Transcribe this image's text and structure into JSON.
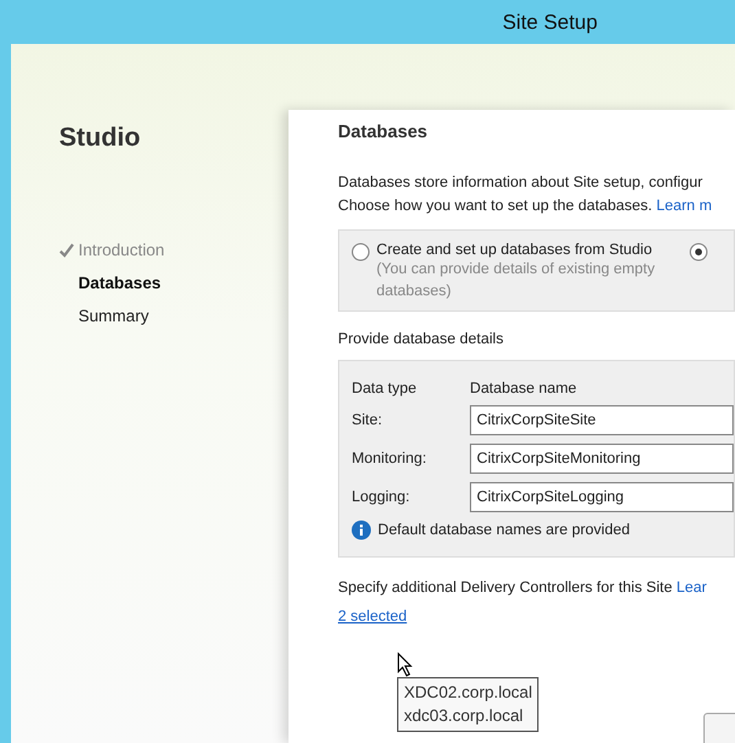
{
  "window": {
    "title": "Site Setup"
  },
  "sidebar": {
    "title": "Studio",
    "items": [
      {
        "label": "Introduction",
        "completed": true,
        "selected": false
      },
      {
        "label": "Databases",
        "completed": false,
        "selected": true
      },
      {
        "label": "Summary",
        "completed": false,
        "selected": false
      }
    ]
  },
  "page": {
    "heading": "Databases",
    "description_line_1": "Databases store information about Site setup, configur",
    "description_line_2": "Choose how you want to set up the databases.",
    "learn_more_link_1": "Learn m",
    "options": [
      {
        "label": "Create and set up databases from Studio",
        "hint": "(You can provide details of existing empty databases)",
        "selected": false
      },
      {
        "selected": true
      }
    ],
    "details_label": "Provide database details",
    "table": {
      "columns": [
        "Data type",
        "Database name"
      ],
      "rows": [
        {
          "label": "Site:",
          "value": "CitrixCorpSiteSite"
        },
        {
          "label": "Monitoring:",
          "value": "CitrixCorpSiteMonitoring"
        },
        {
          "label": "Logging:",
          "value": "CitrixCorpSiteLogging"
        }
      ],
      "info": "Default database names are provided"
    },
    "controllers_label": "Specify additional Delivery Controllers for this Site",
    "learn_more_link_2": "Lear",
    "selected_link": "2 selected",
    "tooltip": [
      "XDC02.corp.local",
      "xdc03.corp.local"
    ]
  }
}
